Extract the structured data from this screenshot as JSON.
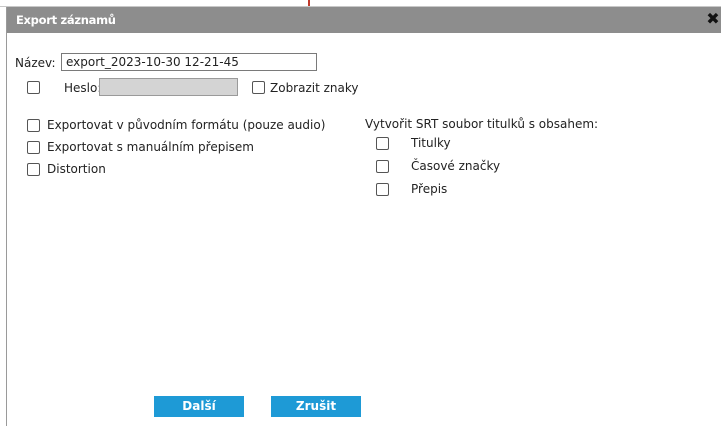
{
  "dialog": {
    "title": "Export záznamů",
    "close_icon": "close-icon"
  },
  "form": {
    "name_label": "Název:",
    "name_value": "export_2023-10-30 12-21-45",
    "password_label": "Heslo:",
    "password_value": "",
    "show_chars_label": "Zobrazit znaky"
  },
  "options": {
    "export_original_label": "Exportovat v původním formátu (pouze audio)",
    "export_manual_label": "Exportovat s manuálním přepisem",
    "distortion_label": "Distortion"
  },
  "srt": {
    "heading": "Vytvořit SRT soubor titulků s obsahem:",
    "items": [
      {
        "label": "Titulky",
        "checked": false
      },
      {
        "label": "Časové značky",
        "checked": false
      },
      {
        "label": "Přepis",
        "checked": false
      }
    ]
  },
  "buttons": {
    "next_label": "Další",
    "cancel_label": "Zrušit"
  },
  "colors": {
    "titlebar": "#8d8d8d",
    "button": "#1e9ad6",
    "disabled_field": "#d4d4d4"
  }
}
